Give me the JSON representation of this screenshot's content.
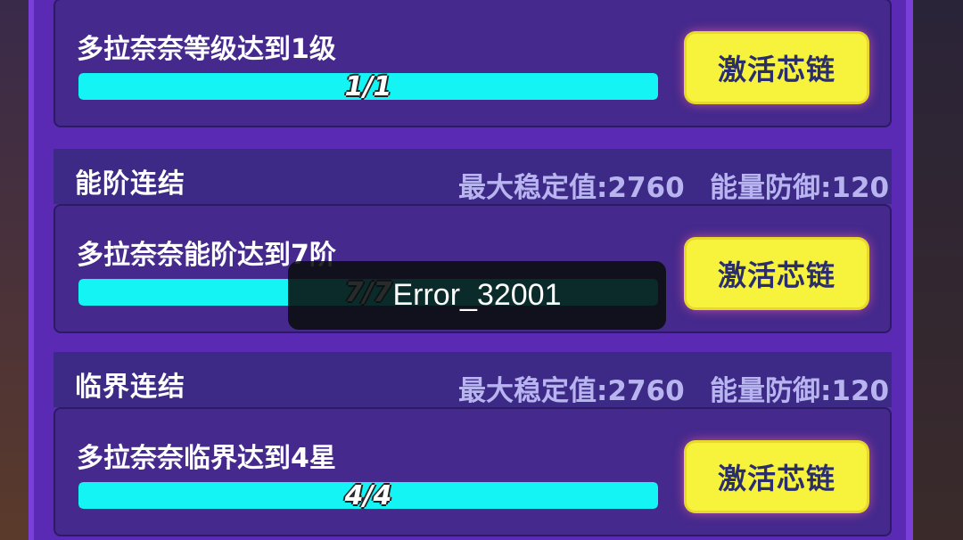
{
  "sections": [
    {
      "condition": "多拉奈奈等级达到1级",
      "progress": {
        "current": 1,
        "total": 1,
        "text": "1/1",
        "fraction": 1.0
      },
      "button_label": "激活芯链"
    },
    {
      "title": "能阶连结",
      "stability": "最大稳定值:2760",
      "defense": "能量防御:120",
      "condition": "多拉奈奈能阶达到7阶",
      "progress": {
        "current": 7,
        "total": 7,
        "text": "7/7",
        "fraction": 1.0
      },
      "button_label": "激活芯链"
    },
    {
      "title": "临界连结",
      "stability": "最大稳定值:2760",
      "defense": "能量防御:120",
      "condition": "多拉奈奈临界达到4星",
      "progress": {
        "current": 4,
        "total": 4,
        "text": "4/4",
        "fraction": 1.0
      },
      "button_label": "激活芯链"
    }
  ],
  "toast": {
    "message": "Error_32001"
  },
  "colors": {
    "panel": "#5a2ab4",
    "card": "#45298c",
    "header": "#3d2a86",
    "progress_fill": "#15f4f4",
    "button": "#f7f23c",
    "button_text": "#2a2e6e",
    "stat_text": "#b8b4f0"
  }
}
